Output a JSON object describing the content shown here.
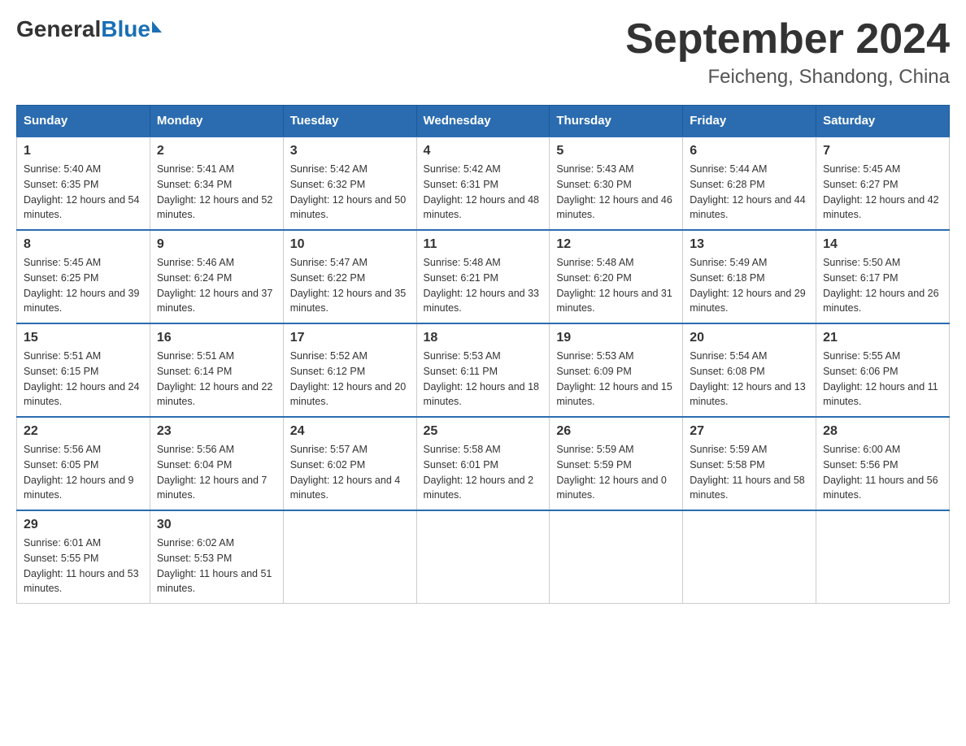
{
  "logo": {
    "general": "General",
    "blue": "Blue"
  },
  "title": "September 2024",
  "location": "Feicheng, Shandong, China",
  "days_of_week": [
    "Sunday",
    "Monday",
    "Tuesday",
    "Wednesday",
    "Thursday",
    "Friday",
    "Saturday"
  ],
  "weeks": [
    [
      {
        "day": "1",
        "sunrise": "5:40 AM",
        "sunset": "6:35 PM",
        "daylight": "12 hours and 54 minutes."
      },
      {
        "day": "2",
        "sunrise": "5:41 AM",
        "sunset": "6:34 PM",
        "daylight": "12 hours and 52 minutes."
      },
      {
        "day": "3",
        "sunrise": "5:42 AM",
        "sunset": "6:32 PM",
        "daylight": "12 hours and 50 minutes."
      },
      {
        "day": "4",
        "sunrise": "5:42 AM",
        "sunset": "6:31 PM",
        "daylight": "12 hours and 48 minutes."
      },
      {
        "day": "5",
        "sunrise": "5:43 AM",
        "sunset": "6:30 PM",
        "daylight": "12 hours and 46 minutes."
      },
      {
        "day": "6",
        "sunrise": "5:44 AM",
        "sunset": "6:28 PM",
        "daylight": "12 hours and 44 minutes."
      },
      {
        "day": "7",
        "sunrise": "5:45 AM",
        "sunset": "6:27 PM",
        "daylight": "12 hours and 42 minutes."
      }
    ],
    [
      {
        "day": "8",
        "sunrise": "5:45 AM",
        "sunset": "6:25 PM",
        "daylight": "12 hours and 39 minutes."
      },
      {
        "day": "9",
        "sunrise": "5:46 AM",
        "sunset": "6:24 PM",
        "daylight": "12 hours and 37 minutes."
      },
      {
        "day": "10",
        "sunrise": "5:47 AM",
        "sunset": "6:22 PM",
        "daylight": "12 hours and 35 minutes."
      },
      {
        "day": "11",
        "sunrise": "5:48 AM",
        "sunset": "6:21 PM",
        "daylight": "12 hours and 33 minutes."
      },
      {
        "day": "12",
        "sunrise": "5:48 AM",
        "sunset": "6:20 PM",
        "daylight": "12 hours and 31 minutes."
      },
      {
        "day": "13",
        "sunrise": "5:49 AM",
        "sunset": "6:18 PM",
        "daylight": "12 hours and 29 minutes."
      },
      {
        "day": "14",
        "sunrise": "5:50 AM",
        "sunset": "6:17 PM",
        "daylight": "12 hours and 26 minutes."
      }
    ],
    [
      {
        "day": "15",
        "sunrise": "5:51 AM",
        "sunset": "6:15 PM",
        "daylight": "12 hours and 24 minutes."
      },
      {
        "day": "16",
        "sunrise": "5:51 AM",
        "sunset": "6:14 PM",
        "daylight": "12 hours and 22 minutes."
      },
      {
        "day": "17",
        "sunrise": "5:52 AM",
        "sunset": "6:12 PM",
        "daylight": "12 hours and 20 minutes."
      },
      {
        "day": "18",
        "sunrise": "5:53 AM",
        "sunset": "6:11 PM",
        "daylight": "12 hours and 18 minutes."
      },
      {
        "day": "19",
        "sunrise": "5:53 AM",
        "sunset": "6:09 PM",
        "daylight": "12 hours and 15 minutes."
      },
      {
        "day": "20",
        "sunrise": "5:54 AM",
        "sunset": "6:08 PM",
        "daylight": "12 hours and 13 minutes."
      },
      {
        "day": "21",
        "sunrise": "5:55 AM",
        "sunset": "6:06 PM",
        "daylight": "12 hours and 11 minutes."
      }
    ],
    [
      {
        "day": "22",
        "sunrise": "5:56 AM",
        "sunset": "6:05 PM",
        "daylight": "12 hours and 9 minutes."
      },
      {
        "day": "23",
        "sunrise": "5:56 AM",
        "sunset": "6:04 PM",
        "daylight": "12 hours and 7 minutes."
      },
      {
        "day": "24",
        "sunrise": "5:57 AM",
        "sunset": "6:02 PM",
        "daylight": "12 hours and 4 minutes."
      },
      {
        "day": "25",
        "sunrise": "5:58 AM",
        "sunset": "6:01 PM",
        "daylight": "12 hours and 2 minutes."
      },
      {
        "day": "26",
        "sunrise": "5:59 AM",
        "sunset": "5:59 PM",
        "daylight": "12 hours and 0 minutes."
      },
      {
        "day": "27",
        "sunrise": "5:59 AM",
        "sunset": "5:58 PM",
        "daylight": "11 hours and 58 minutes."
      },
      {
        "day": "28",
        "sunrise": "6:00 AM",
        "sunset": "5:56 PM",
        "daylight": "11 hours and 56 minutes."
      }
    ],
    [
      {
        "day": "29",
        "sunrise": "6:01 AM",
        "sunset": "5:55 PM",
        "daylight": "11 hours and 53 minutes."
      },
      {
        "day": "30",
        "sunrise": "6:02 AM",
        "sunset": "5:53 PM",
        "daylight": "11 hours and 51 minutes."
      },
      null,
      null,
      null,
      null,
      null
    ]
  ]
}
